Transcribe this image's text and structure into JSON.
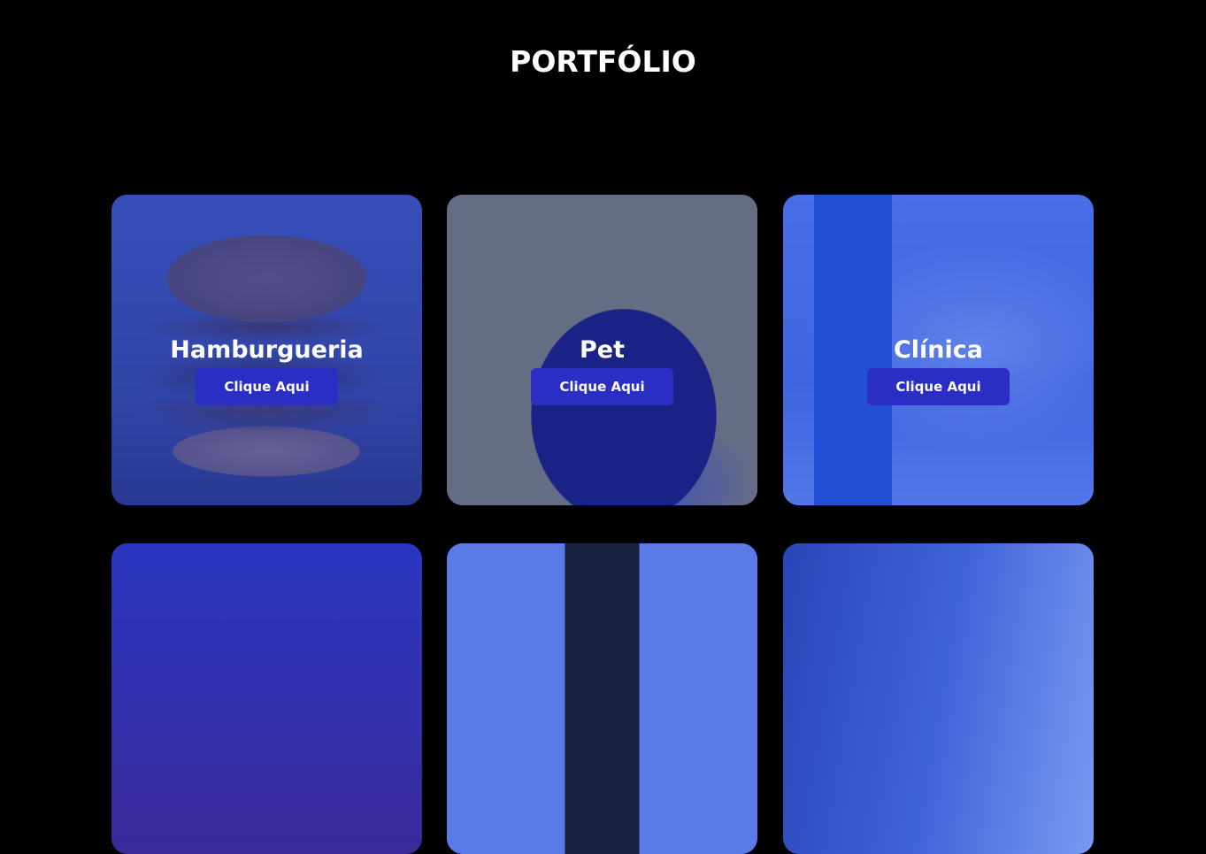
{
  "section": {
    "title": "PORTFÓLIO"
  },
  "cards": [
    {
      "name": "Hamburgueria",
      "button": "Clique Aqui",
      "image": "burger-image"
    },
    {
      "name": "Pet",
      "button": "Clique Aqui",
      "image": "pug-image"
    },
    {
      "name": "Clínica",
      "button": "Clique Aqui",
      "image": "clinic-reception-image"
    },
    {
      "image": "storefront-image"
    },
    {
      "image": "clothes-hanger-image"
    },
    {
      "image": "office-image"
    }
  ],
  "colors": {
    "background": "#000000",
    "button": "#2a2ec4",
    "overlay": "#2846c8"
  }
}
